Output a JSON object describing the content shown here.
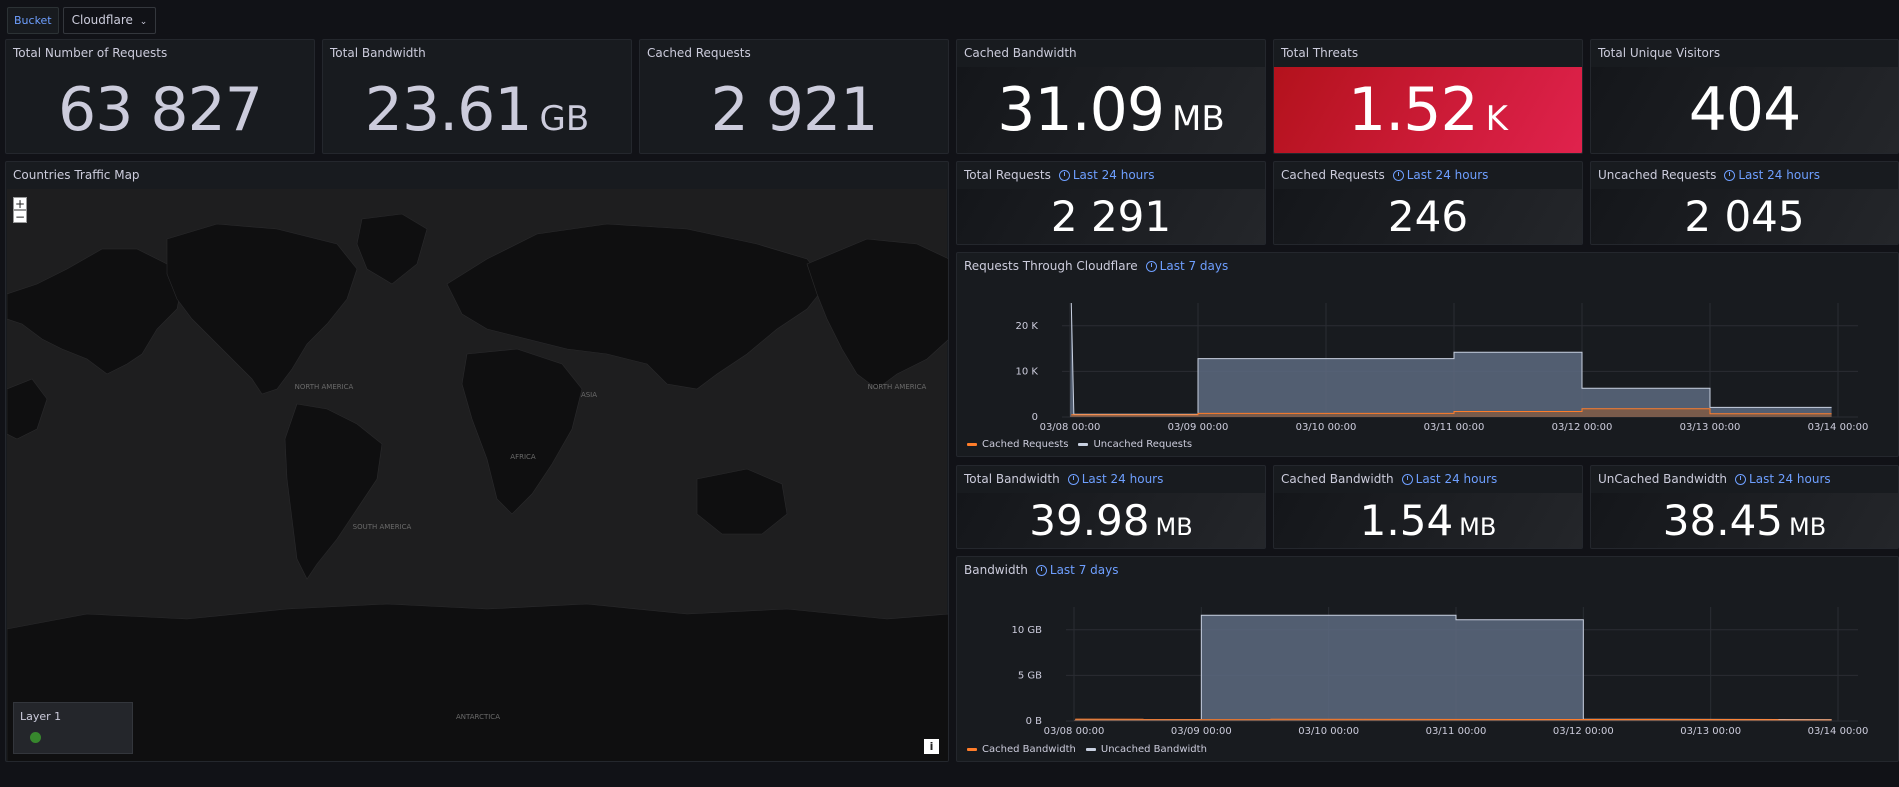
{
  "toolbar": {
    "bucket_label": "Bucket",
    "datasource_value": "Cloudflare"
  },
  "colors": {
    "cached": "#ff7d2a",
    "uncached": "#c8d0e0",
    "uncached_fill": "#5d6a80",
    "cached_fill": "#8a5a3c"
  },
  "stats_top": [
    {
      "title": "Total Number of Requests",
      "value": "63 827",
      "unit": ""
    },
    {
      "title": "Total Bandwidth",
      "value": "23.61",
      "unit": "GB"
    },
    {
      "title": "Cached Requests",
      "value": "2 921",
      "unit": ""
    },
    {
      "title": "Cached Bandwidth",
      "value": "31.09",
      "unit": "MB"
    },
    {
      "title": "Total Threats",
      "value": "1.52",
      "unit": "K"
    },
    {
      "title": "Total Unique Visitors",
      "value": "404",
      "unit": ""
    }
  ],
  "map": {
    "title": "Countries Traffic Map",
    "zoom_in": "+",
    "zoom_out": "−",
    "layer_label": "Layer 1",
    "info": "i",
    "labels": [
      "NORTH AMERICA",
      "ASIA",
      "NORTH AMERICA",
      "AFRICA",
      "SOUTH AMERICA",
      "ANTARCTICA"
    ]
  },
  "stats_requests": [
    {
      "title": "Total Requests",
      "range": "Last 24 hours",
      "value": "2 291"
    },
    {
      "title": "Cached Requests",
      "range": "Last 24 hours",
      "value": "246"
    },
    {
      "title": "Uncached Requests",
      "range": "Last 24 hours",
      "value": "2 045"
    }
  ],
  "stats_bandwidth": [
    {
      "title": "Total Bandwidth",
      "range": "Last 24 hours",
      "value": "39.98",
      "unit": "MB"
    },
    {
      "title": "Cached Bandwidth",
      "range": "Last 24 hours",
      "value": "1.54",
      "unit": "MB"
    },
    {
      "title": "UnCached Bandwidth",
      "range": "Last 24 hours",
      "value": "38.45",
      "unit": "MB"
    }
  ],
  "chart_data": [
    {
      "type": "area",
      "title": "Requests Through Cloudflare",
      "range": "Last 7 days",
      "x_ticks": [
        "03/08 00:00",
        "03/09 00:00",
        "03/10 00:00",
        "03/11 00:00",
        "03/12 00:00",
        "03/13 00:00",
        "03/14 00:00"
      ],
      "y_ticks": [
        "0",
        "10 K",
        "20 K"
      ],
      "ylim": [
        0,
        25000
      ],
      "x_range": [
        0,
        6
      ],
      "series": [
        {
          "name": "Cached Requests",
          "color": "#ff7d2a",
          "points": [
            [
              0,
              0
            ],
            [
              0.01,
              500
            ],
            [
              1,
              500
            ],
            [
              1,
              800
            ],
            [
              3,
              800
            ],
            [
              3,
              1200
            ],
            [
              4,
              1200
            ],
            [
              4,
              1800
            ],
            [
              5,
              1800
            ],
            [
              5,
              700
            ],
            [
              5.95,
              700
            ],
            [
              5.95,
              0
            ]
          ]
        },
        {
          "name": "Uncached Requests",
          "color": "#c8d0e0",
          "points": [
            [
              0,
              0
            ],
            [
              0.01,
              25000
            ],
            [
              0.03,
              600
            ],
            [
              1,
              600
            ],
            [
              1,
              12800
            ],
            [
              3,
              12800
            ],
            [
              3,
              14200
            ],
            [
              4,
              14200
            ],
            [
              4,
              6300
            ],
            [
              5,
              6300
            ],
            [
              5,
              2100
            ],
            [
              5.95,
              2100
            ],
            [
              5.95,
              0
            ]
          ]
        }
      ]
    },
    {
      "type": "area",
      "title": "Bandwidth",
      "range": "Last 7 days",
      "x_ticks": [
        "03/08 00:00",
        "03/09 00:00",
        "03/10 00:00",
        "03/11 00:00",
        "03/12 00:00",
        "03/13 00:00",
        "03/14 00:00"
      ],
      "y_ticks": [
        "0 B",
        "5 GB",
        "10 GB"
      ],
      "ylim": [
        0,
        12500
      ],
      "x_range": [
        0,
        6
      ],
      "series": [
        {
          "name": "Cached Bandwidth",
          "color": "#ff7d2a",
          "points": [
            [
              0,
              0
            ],
            [
              0.01,
              200
            ],
            [
              5.95,
              150
            ],
            [
              5.95,
              0
            ]
          ]
        },
        {
          "name": "Uncached Bandwidth",
          "color": "#c8d0e0",
          "points": [
            [
              0,
              0
            ],
            [
              0.01,
              150
            ],
            [
              1,
              150
            ],
            [
              1,
              11600
            ],
            [
              3,
              11600
            ],
            [
              3,
              11100
            ],
            [
              4,
              11100
            ],
            [
              4,
              200
            ],
            [
              5.95,
              150
            ],
            [
              5.95,
              0
            ]
          ]
        }
      ]
    }
  ]
}
